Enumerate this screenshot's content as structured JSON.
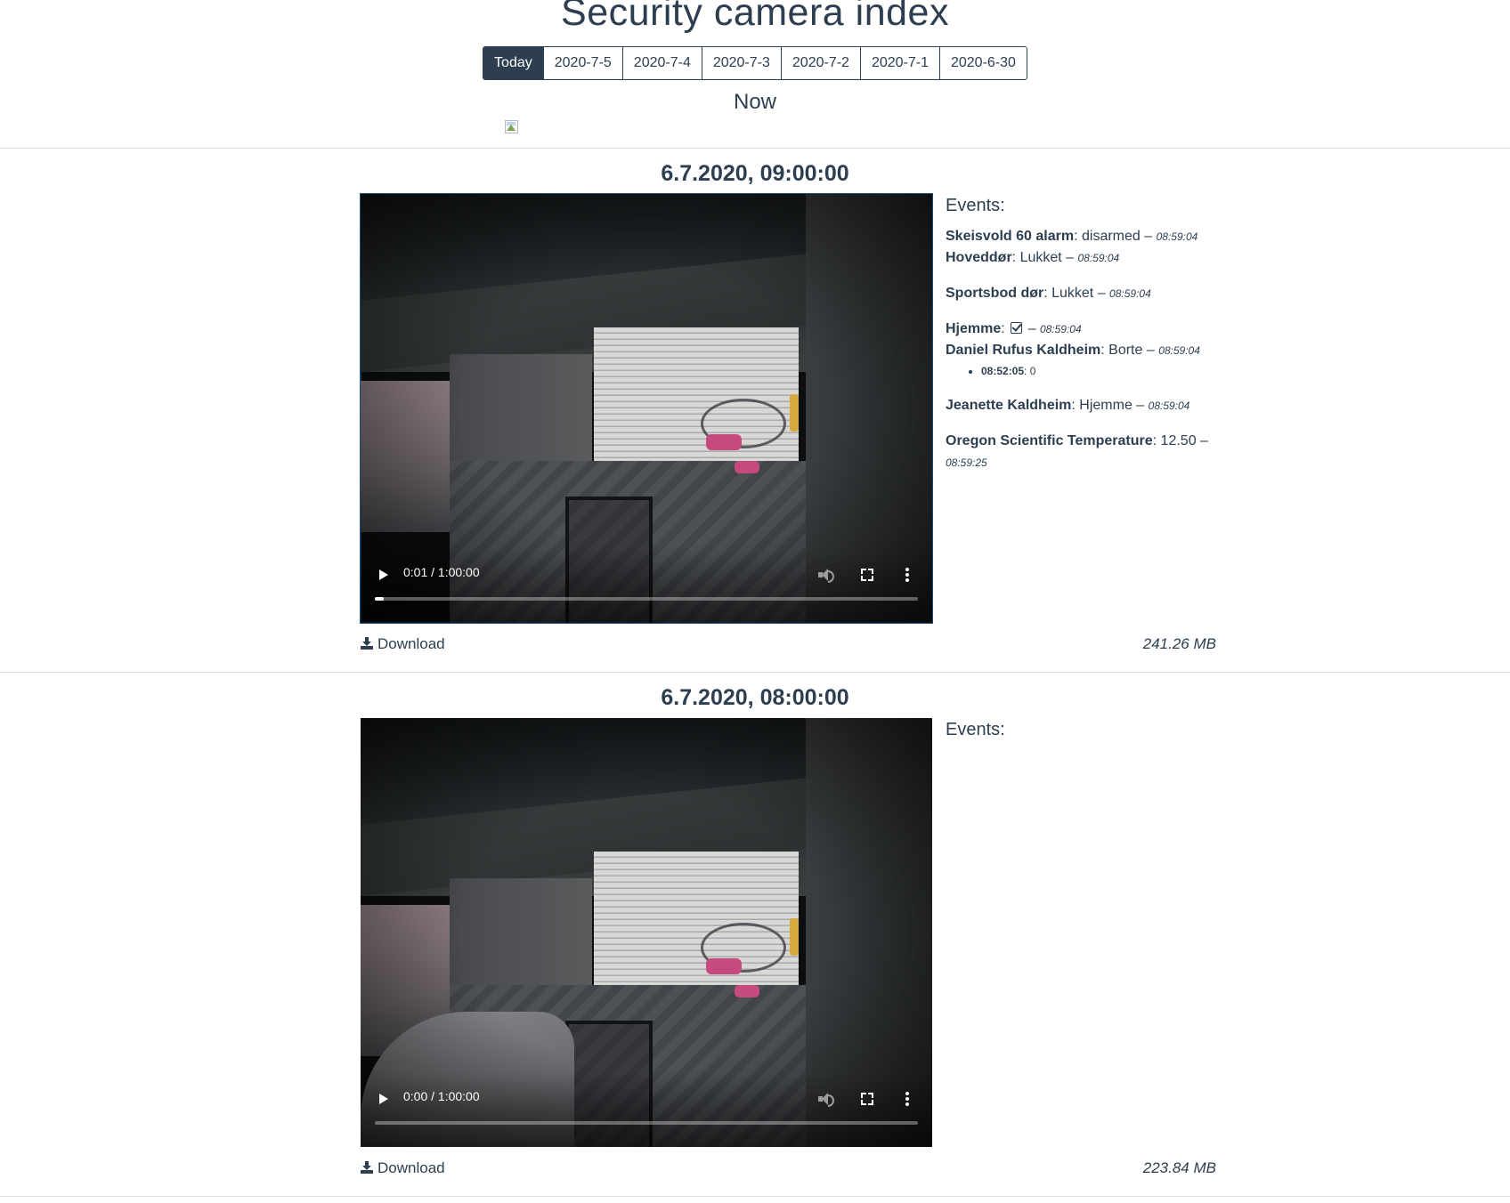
{
  "page": {
    "title": "Security camera index"
  },
  "date_tabs": [
    {
      "label": "Today",
      "active": true
    },
    {
      "label": "2020-7-5"
    },
    {
      "label": "2020-7-4"
    },
    {
      "label": "2020-7-3"
    },
    {
      "label": "2020-7-2"
    },
    {
      "label": "2020-7-1"
    },
    {
      "label": "2020-6-30"
    }
  ],
  "now": {
    "heading": "Now",
    "image_icon": "broken-image-icon"
  },
  "clips": [
    {
      "title": "6.7.2020, 09:00:00",
      "video": {
        "time": "0:01 / 1:00:00",
        "progress": 0.017
      },
      "events_heading": "Events:",
      "events": {
        "e1": {
          "name": "Skeisvold 60 alarm",
          "value": "disarmed",
          "time": "08:59:04"
        },
        "e2": {
          "name": "Hoveddør",
          "value": "Lukket",
          "time": "08:59:04"
        },
        "e3": {
          "name": "Sportsbod dør",
          "value": "Lukket",
          "time": "08:59:04"
        },
        "e4": {
          "name": "Hjemme",
          "icon": "checkbox-checked-icon",
          "time": "08:59:04"
        },
        "e5": {
          "name": "Daniel Rufus Kaldheim",
          "value": "Borte",
          "time": "08:59:04",
          "sub": {
            "time": "08:52:05",
            "value": "0"
          }
        },
        "e6": {
          "name": "Jeanette Kaldheim",
          "value": "Hjemme",
          "time": "08:59:04"
        },
        "e7": {
          "name": "Oregon Scientific Temperature",
          "value": "12.50",
          "time": "08:59:25"
        }
      },
      "download_label": "Download",
      "file_size": "241.26 MB"
    },
    {
      "title": "6.7.2020, 08:00:00",
      "video": {
        "time": "0:00 / 1:00:00",
        "progress": 0.0
      },
      "events_heading": "Events:",
      "download_label": "Download",
      "file_size": "223.84 MB"
    }
  ]
}
